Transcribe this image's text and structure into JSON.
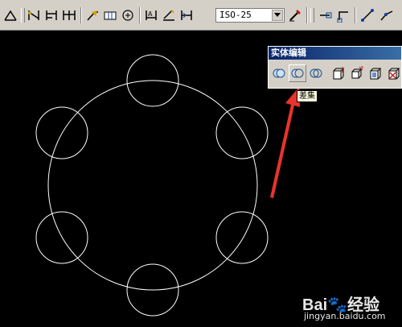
{
  "toolbar": {
    "dim_style_value": "ISO-25",
    "icons": [
      "linear-dim-icon",
      "aligned-dim-icon",
      "baseline-dim-icon",
      "continue-dim-icon",
      "leader-icon",
      "tolerance-icon",
      "center-mark-icon",
      "edit-dim-icon",
      "edit-dim-text-icon",
      "update-dim-icon",
      "dim-style-icon",
      "osnap-endpoint-icon",
      "osnap-midpoint-icon",
      "line-icon",
      "polyline-icon"
    ]
  },
  "solid_edit_panel": {
    "title": "实体编辑",
    "buttons": [
      "union-icon",
      "subtract-icon",
      "intersect-icon",
      "extrude-faces-icon",
      "move-faces-icon",
      "offset-faces-icon",
      "delete-faces-icon"
    ],
    "tooltip": "差集"
  },
  "watermark": {
    "logo_text": "Bai",
    "logo_text_2": "经验",
    "url": "jingyan.baidu.com"
  },
  "colors": {
    "canvas_bg": "#000000",
    "geometry_stroke": "#ffffff",
    "arrow": "#e8342c",
    "toolbar_bg": "#d4d0c8",
    "title_bar": "#0a246a"
  }
}
